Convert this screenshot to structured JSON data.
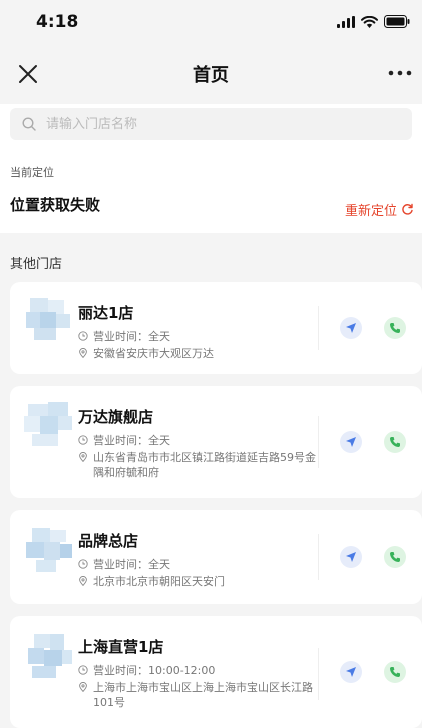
{
  "status_bar": {
    "time": "4:18"
  },
  "nav": {
    "title": "首页"
  },
  "search": {
    "placeholder": "请输入门店名称"
  },
  "location": {
    "label": "当前定位",
    "status": "位置获取失败",
    "relocate_label": "重新定位",
    "accent_color": "#e5442b"
  },
  "other_stores_title": "其他门店",
  "stores": [
    {
      "name": "丽达1店",
      "hours": "营业时间：全天",
      "address": "安徽省安庆市大观区万达"
    },
    {
      "name": "万达旗舰店",
      "hours": "营业时间：全天",
      "address": "山东省青岛市市北区镇江路街道延吉路59号金隅和府毓和府"
    },
    {
      "name": "品牌总店",
      "hours": "营业时间：全天",
      "address": "北京市北京市朝阳区天安门"
    },
    {
      "name": "上海直营1店",
      "hours": "营业时间：10:00-12:00",
      "address": "上海市上海市宝山区上海上海市宝山区长江路101号"
    }
  ],
  "icons": {
    "close": "close-icon",
    "more": "more-icon",
    "search": "search-icon",
    "refresh": "refresh-icon",
    "clock": "clock-icon",
    "pin": "location-pin-icon",
    "navigate": "navigate-icon",
    "phone": "phone-icon"
  }
}
